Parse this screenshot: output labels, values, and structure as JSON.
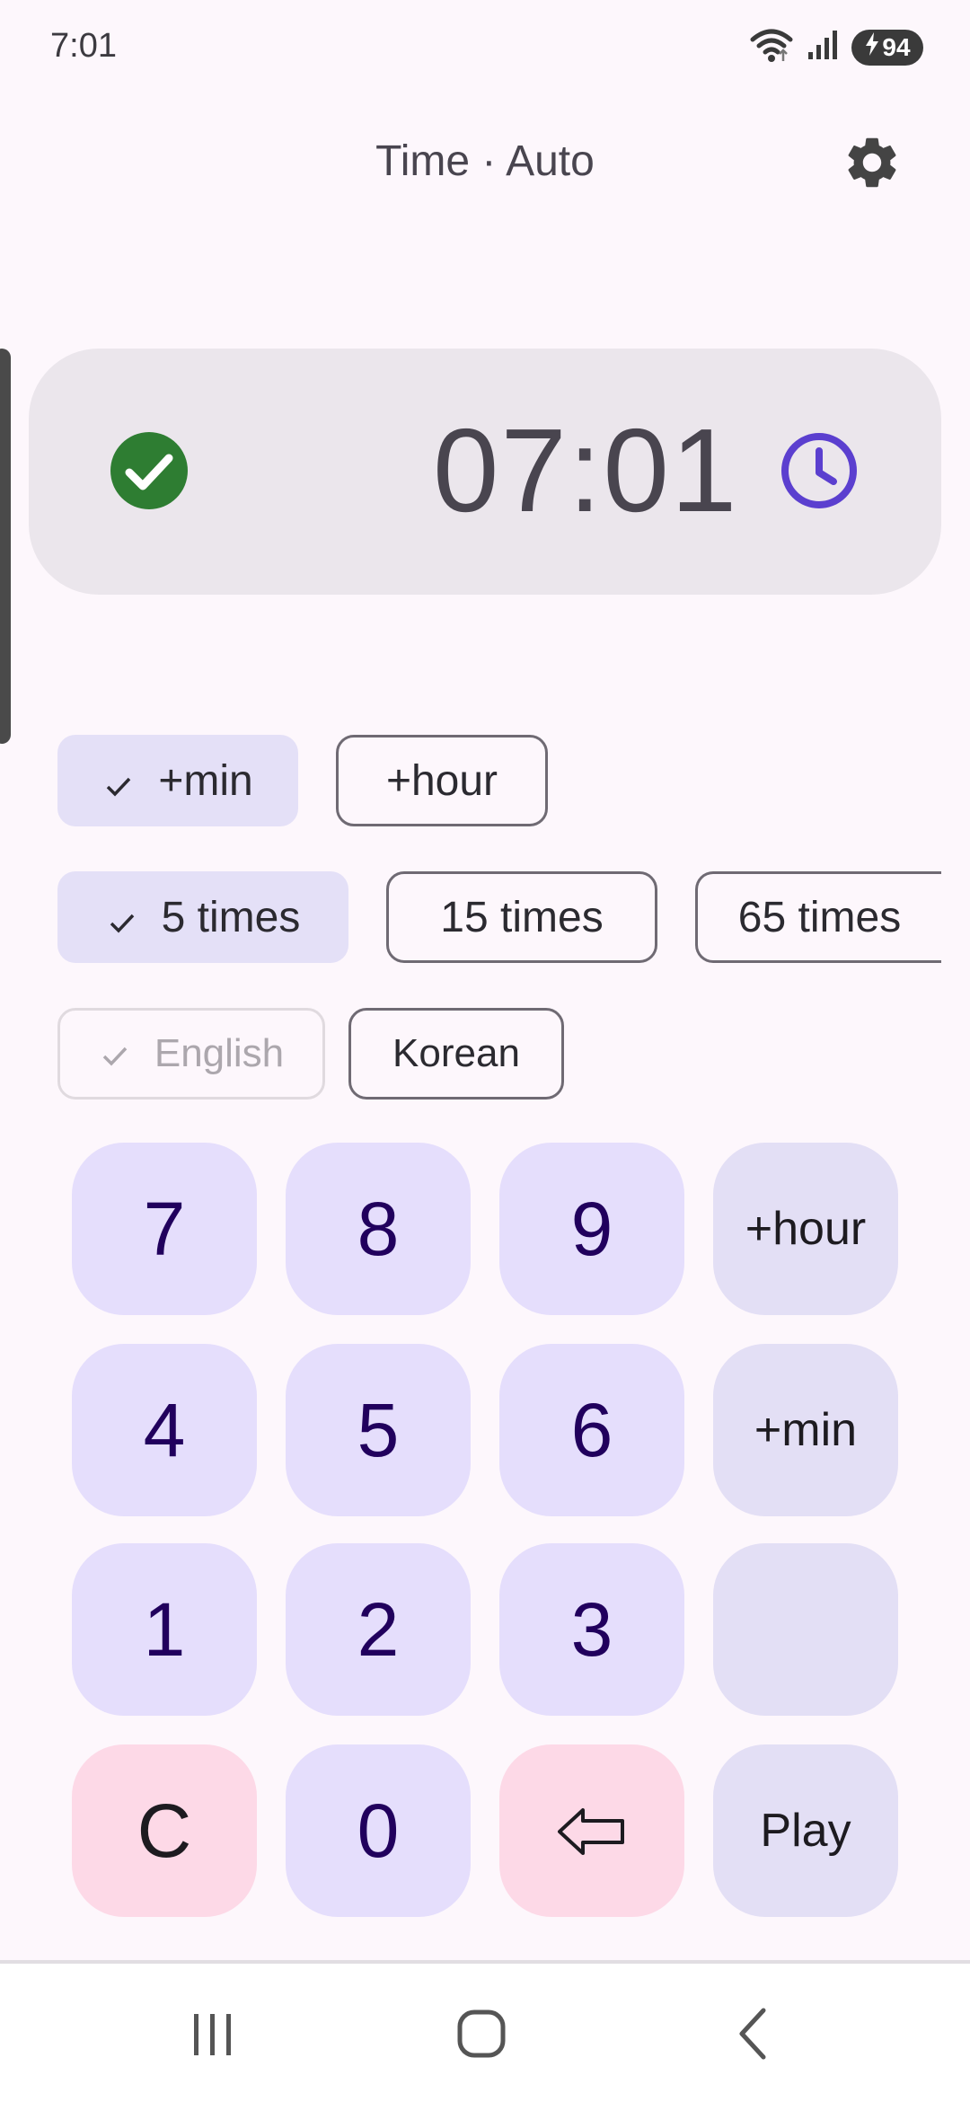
{
  "status_bar": {
    "time": "7:01",
    "battery": "94"
  },
  "header": {
    "title": "Time · Auto"
  },
  "display": {
    "time": "07:01"
  },
  "chips": {
    "increment": [
      {
        "label": "+min",
        "selected": true
      },
      {
        "label": "+hour",
        "selected": false
      }
    ],
    "repeat": [
      {
        "label": "5 times",
        "selected": true
      },
      {
        "label": "15 times",
        "selected": false
      },
      {
        "label": "65 times",
        "selected": false
      }
    ],
    "language": [
      {
        "label": "English",
        "selected": true,
        "disabled": true
      },
      {
        "label": "Korean",
        "selected": false
      }
    ]
  },
  "keypad": {
    "k7": "7",
    "k8": "8",
    "k9": "9",
    "plus_hour": "+hour",
    "k4": "4",
    "k5": "5",
    "k6": "6",
    "plus_min": "+min",
    "k1": "1",
    "k2": "2",
    "k3": "3",
    "blank": "",
    "clear": "C",
    "k0": "0",
    "play": "Play"
  },
  "colors": {
    "background": "#fdf7fc",
    "card": "#ebe6ec",
    "check": "#2e7d32",
    "clock": "#5b3fcf",
    "key": "#e5defc",
    "key_danger": "#fdd9e7"
  }
}
